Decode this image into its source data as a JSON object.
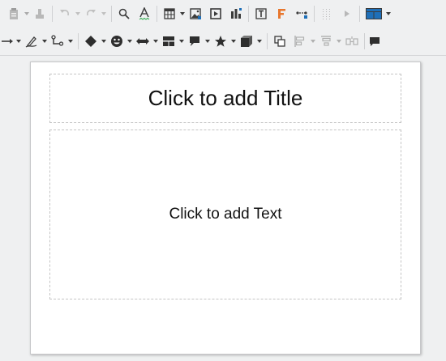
{
  "toolbar_top": {
    "icons": [
      "paste-icon",
      "clone-formatting-icon",
      "undo-icon",
      "redo-icon",
      "find-replace-icon",
      "spelling-icon",
      "insert-table-icon",
      "insert-image-icon",
      "insert-media-icon",
      "insert-chart-icon",
      "insert-textbox-icon",
      "fontwork-icon",
      "connectors-icon",
      "grid-icon",
      "start-slideshow-icon",
      "slide-layout-icon"
    ]
  },
  "toolbar_bottom": {
    "icons": [
      "line-icon",
      "curve-icon",
      "connector-icon",
      "basic-shapes-icon",
      "symbol-shapes-icon",
      "block-arrows-icon",
      "flowchart-icon",
      "callouts-icon",
      "stars-icon",
      "3d-objects-icon",
      "shadow-icon",
      "align-icon",
      "arrange-icon",
      "distribute-icon",
      "insert-comment-icon"
    ]
  },
  "slide": {
    "title_placeholder": "Click to add Title",
    "body_placeholder": "Click to add Text"
  },
  "colors": {
    "toolbar_bg": "#eff0f1",
    "icon_dark": "#3b3b3b",
    "icon_gray": "#a9a9a9",
    "accent_blue": "#1e6fb8",
    "accent_orange": "#e8772e",
    "slide_bg": "#ffffff",
    "placeholder_border": "#c4c4c4"
  }
}
